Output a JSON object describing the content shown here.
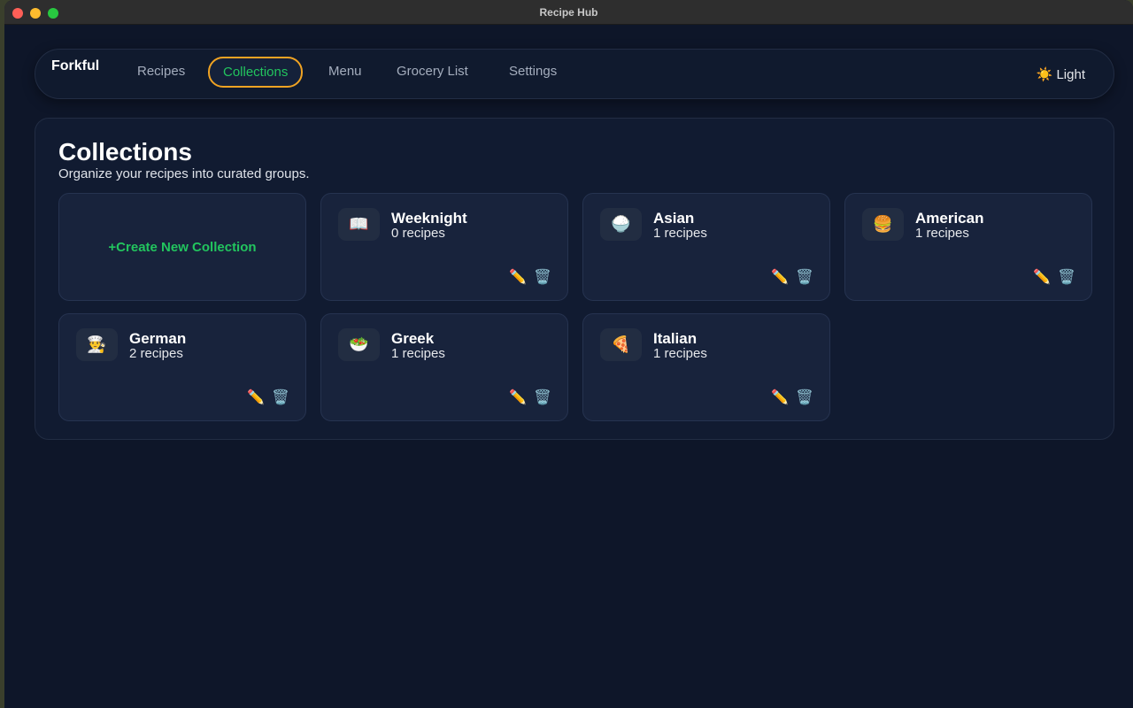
{
  "window": {
    "title": "Recipe Hub"
  },
  "nav": {
    "brand": "Forkful",
    "items": [
      "Recipes",
      "Collections",
      "Menu",
      "Grocery List",
      "Settings"
    ],
    "active": "Collections",
    "theme_icon": "☀️",
    "theme_label": "Light"
  },
  "page": {
    "title": "Collections",
    "subtitle": "Organize your recipes into curated groups.",
    "create_label": "+Create New Collection"
  },
  "collections": [
    {
      "name": "Weeknight",
      "count": "0 recipes",
      "icon": "📖"
    },
    {
      "name": "Asian",
      "count": "1 recipes",
      "icon": "🍚"
    },
    {
      "name": "American",
      "count": "1 recipes",
      "icon": "🍔"
    },
    {
      "name": "German",
      "count": "2 recipes",
      "icon": "👨‍🍳"
    },
    {
      "name": "Greek",
      "count": "1 recipes",
      "icon": "🥗"
    },
    {
      "name": "Italian",
      "count": "1 recipes",
      "icon": "🍕"
    }
  ],
  "actions": {
    "edit_icon": "✏️",
    "delete_icon": "🗑️"
  },
  "colors": {
    "accent": "#22c55e",
    "active_border": "#f0a323"
  }
}
